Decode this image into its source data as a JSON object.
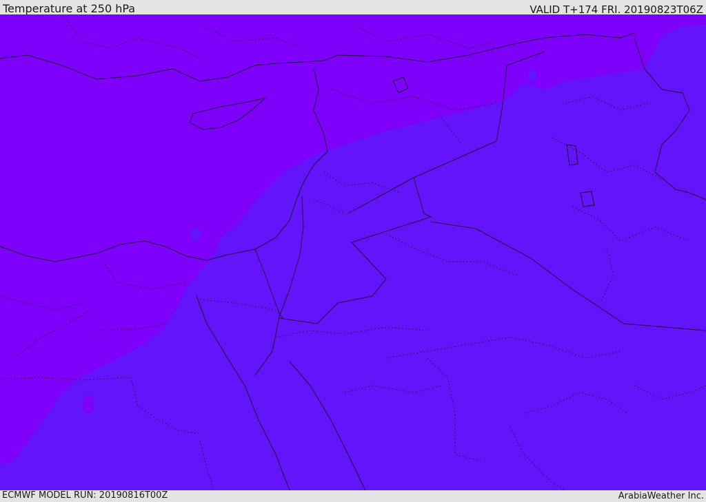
{
  "header": {
    "title": "Temperature at 250 hPa",
    "valid": "VALID T+174 FRI. 20190823T06Z"
  },
  "footer": {
    "model_run": "ECMWF MODEL RUN: 20190816T00Z",
    "brand": "ArabiaWeather Inc."
  },
  "map": {
    "colors": {
      "warm_band": "#7e00fb",
      "cool_band": "#6414fa",
      "coastline": "#1e0f3c",
      "internal_border": "#281446"
    },
    "fill_layers": [
      {
        "name": "temperature-band-cooler",
        "color": "#6414fa"
      },
      {
        "name": "temperature-band-warmer",
        "color": "#7e00fb"
      }
    ]
  }
}
